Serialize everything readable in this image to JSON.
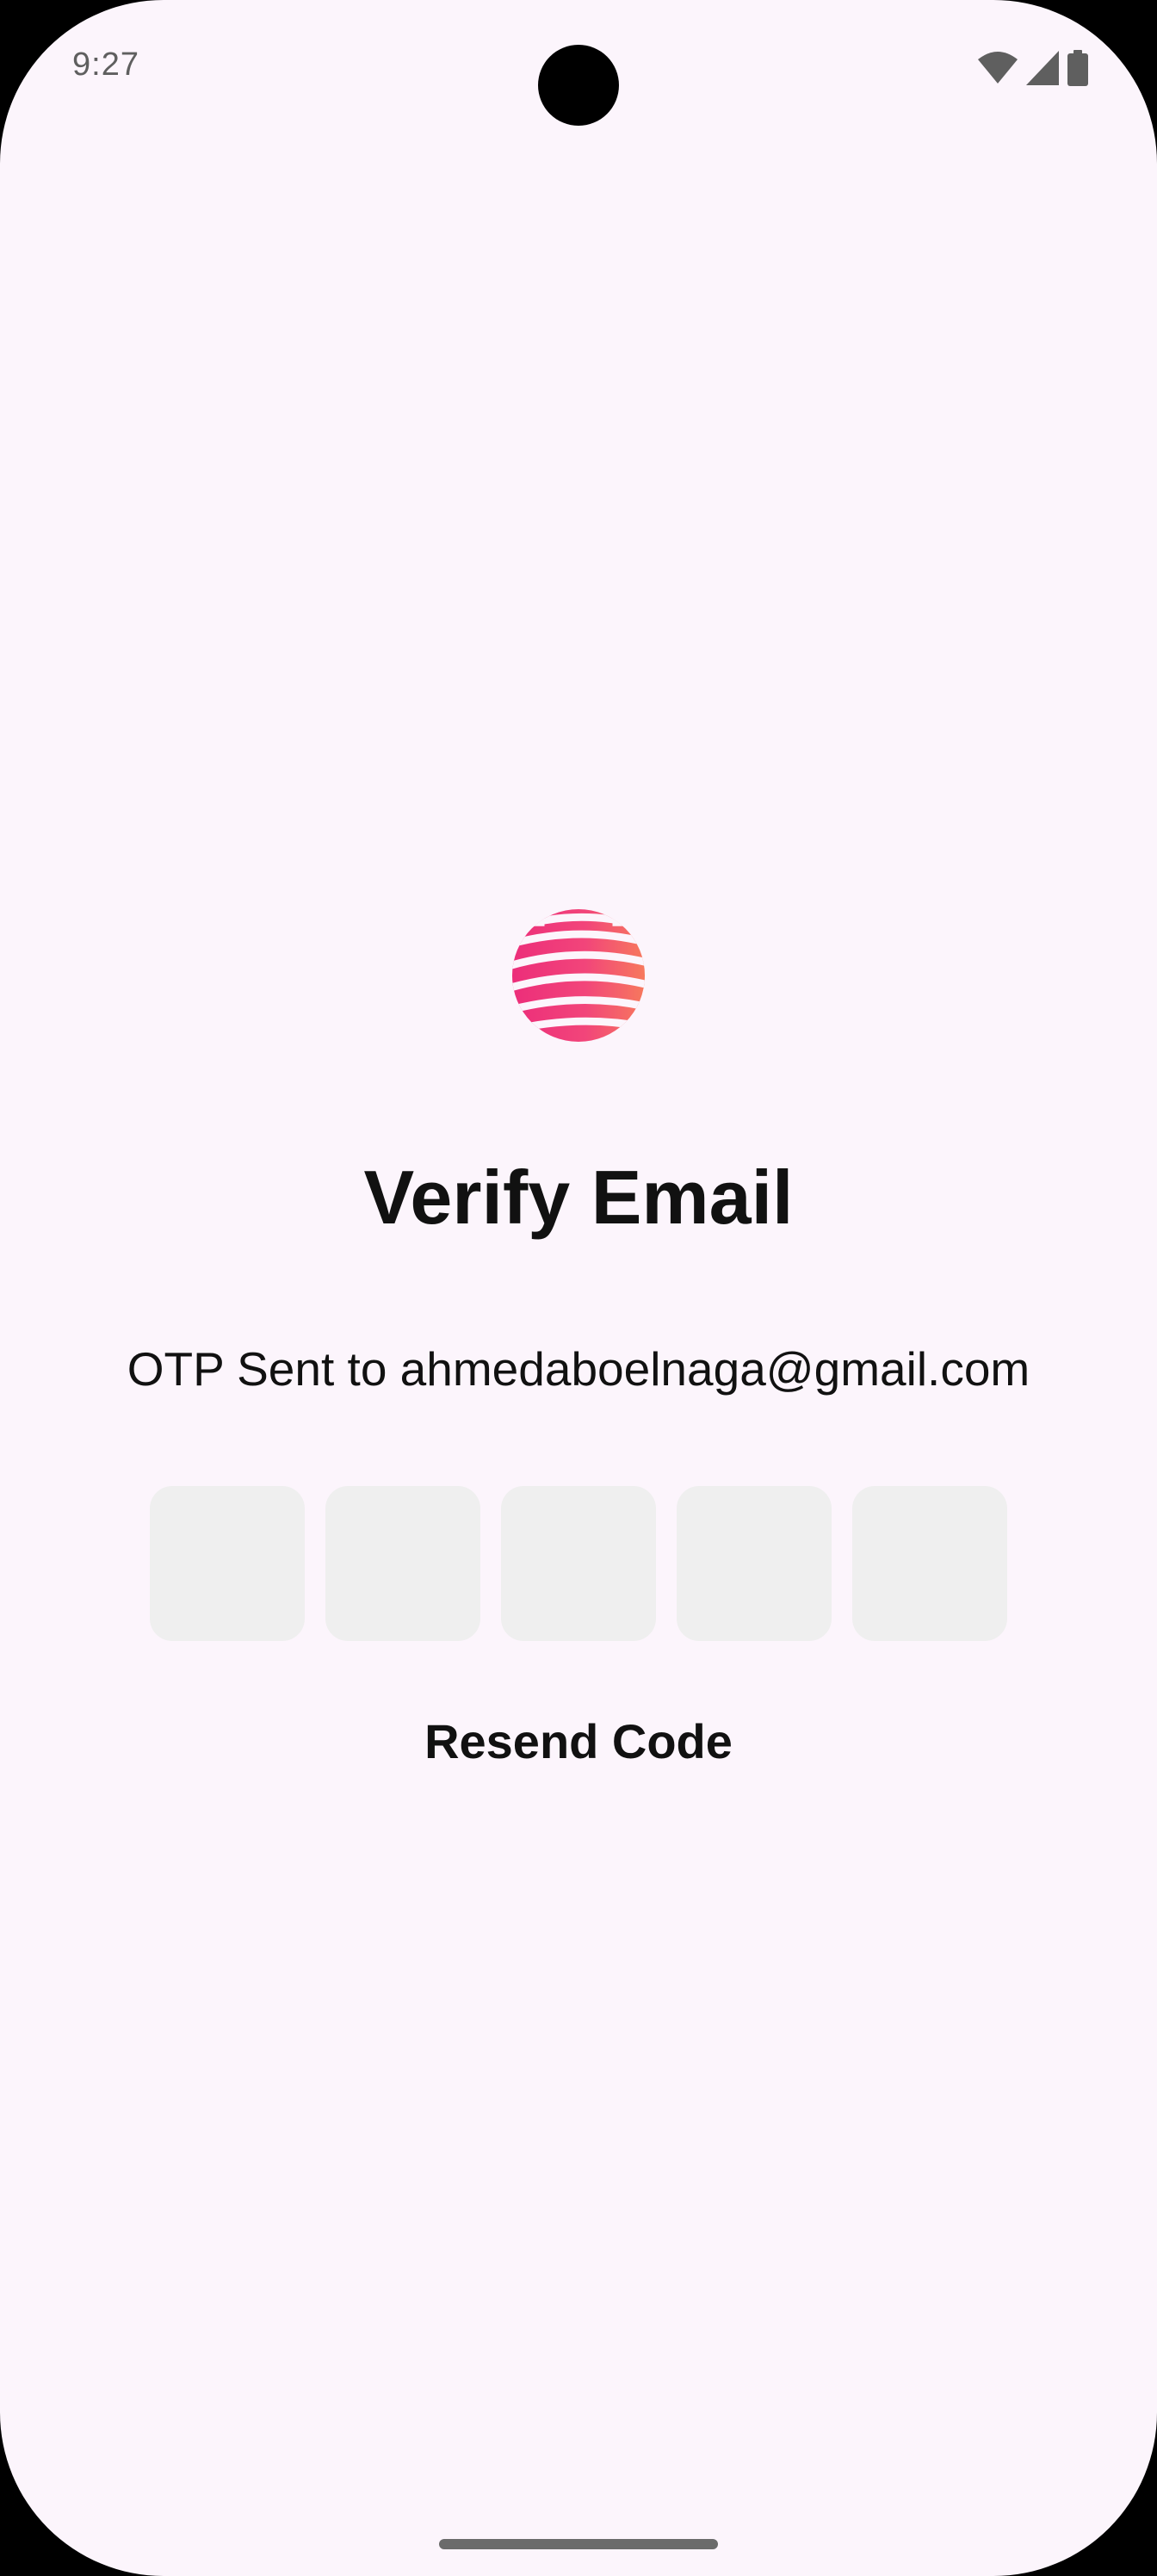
{
  "status_bar": {
    "time": "9:27",
    "icons": [
      "wifi-icon",
      "cellular-signal-icon",
      "battery-icon"
    ]
  },
  "logo": {
    "icon": "striped-globe-logo",
    "colors": [
      "#EC2D7A",
      "#F2457A",
      "#F77A5C"
    ]
  },
  "title": "Verify Email",
  "subtitle": "OTP Sent to ahmedaboelnaga@gmail.com",
  "otp": {
    "digits": [
      "",
      "",
      "",
      "",
      ""
    ]
  },
  "resend_label": "Resend Code",
  "colors": {
    "background": "#FCF5FC",
    "otp_box": "#EFEFEF",
    "text": "#111111"
  }
}
